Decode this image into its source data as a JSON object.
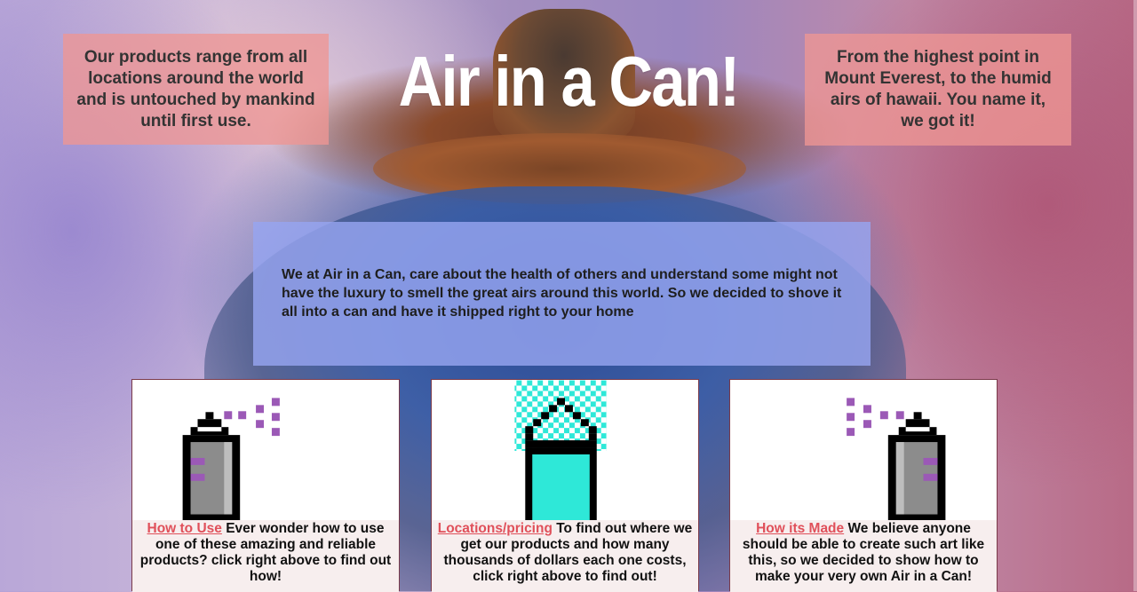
{
  "header": {
    "title": "Air in a Can!",
    "left_blurb": "Our products range from all locations around the world and is untouched by mankind until first use.",
    "right_blurb": "From the highest point in Mount Everest, to the humid airs of hawaii. You name it, we got it!"
  },
  "about": {
    "text": "We at Air in a Can, care about the health of others and understand some might not have the luxury to smell the great airs around this world. So we decided to shove it all into a can and have it shipped right to your home"
  },
  "cards": [
    {
      "link": "How to Use",
      "text": " Ever wonder how to use one of these amazing and reliable products? click right above to find out how!",
      "icon": "spray-can-icon"
    },
    {
      "link": "Locations/pricing",
      "text": " To find out where we get our products and how many thousands of dollars each one costs, click right above to find out!",
      "icon": "air-can-icon"
    },
    {
      "link": "How its Made",
      "text": " We believe anyone should be able to create such art like this, so we decided to show how to make your very own Air in a Can!",
      "icon": "spray-can-icon"
    }
  ],
  "colors": {
    "panel": "#ee9694",
    "about_panel": "#96a5f0",
    "link": "#e0505a",
    "spray": "#9b59b6",
    "can_fill": "#2ee8d8"
  }
}
